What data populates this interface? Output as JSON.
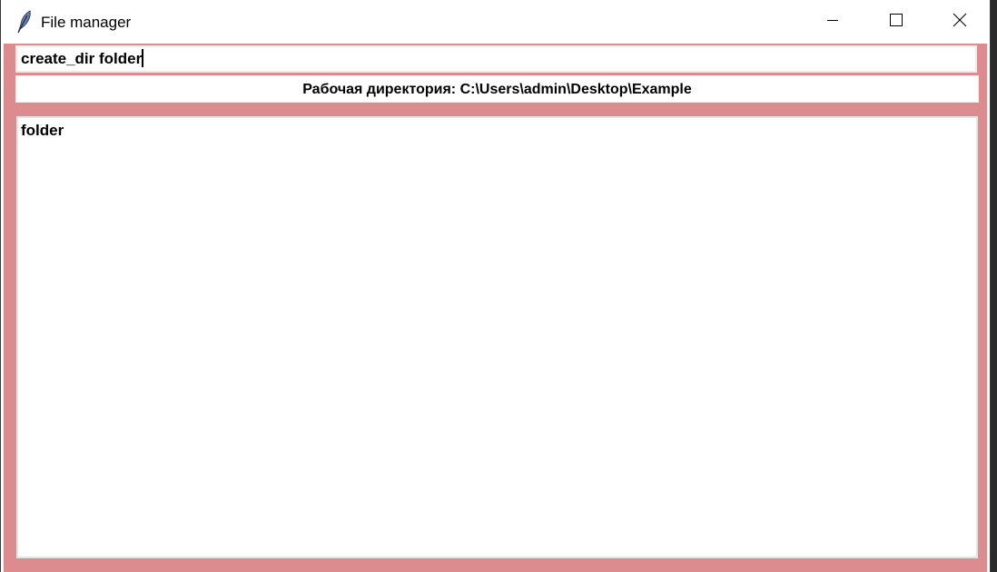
{
  "window": {
    "title": "File manager",
    "app_icon": "feather-icon",
    "controls": {
      "minimize_icon": "minimize-icon",
      "maximize_icon": "maximize-icon",
      "close_icon": "close-icon"
    }
  },
  "command": {
    "value": "create_dir folder"
  },
  "workdir": {
    "text": "Рабочая директория: C:\\Users\\admin\\Desktop\\Example"
  },
  "listing": {
    "items": [
      "folder"
    ]
  },
  "colors": {
    "background": "#dc8b8e",
    "panel": "#ffffff",
    "text": "#000000"
  }
}
